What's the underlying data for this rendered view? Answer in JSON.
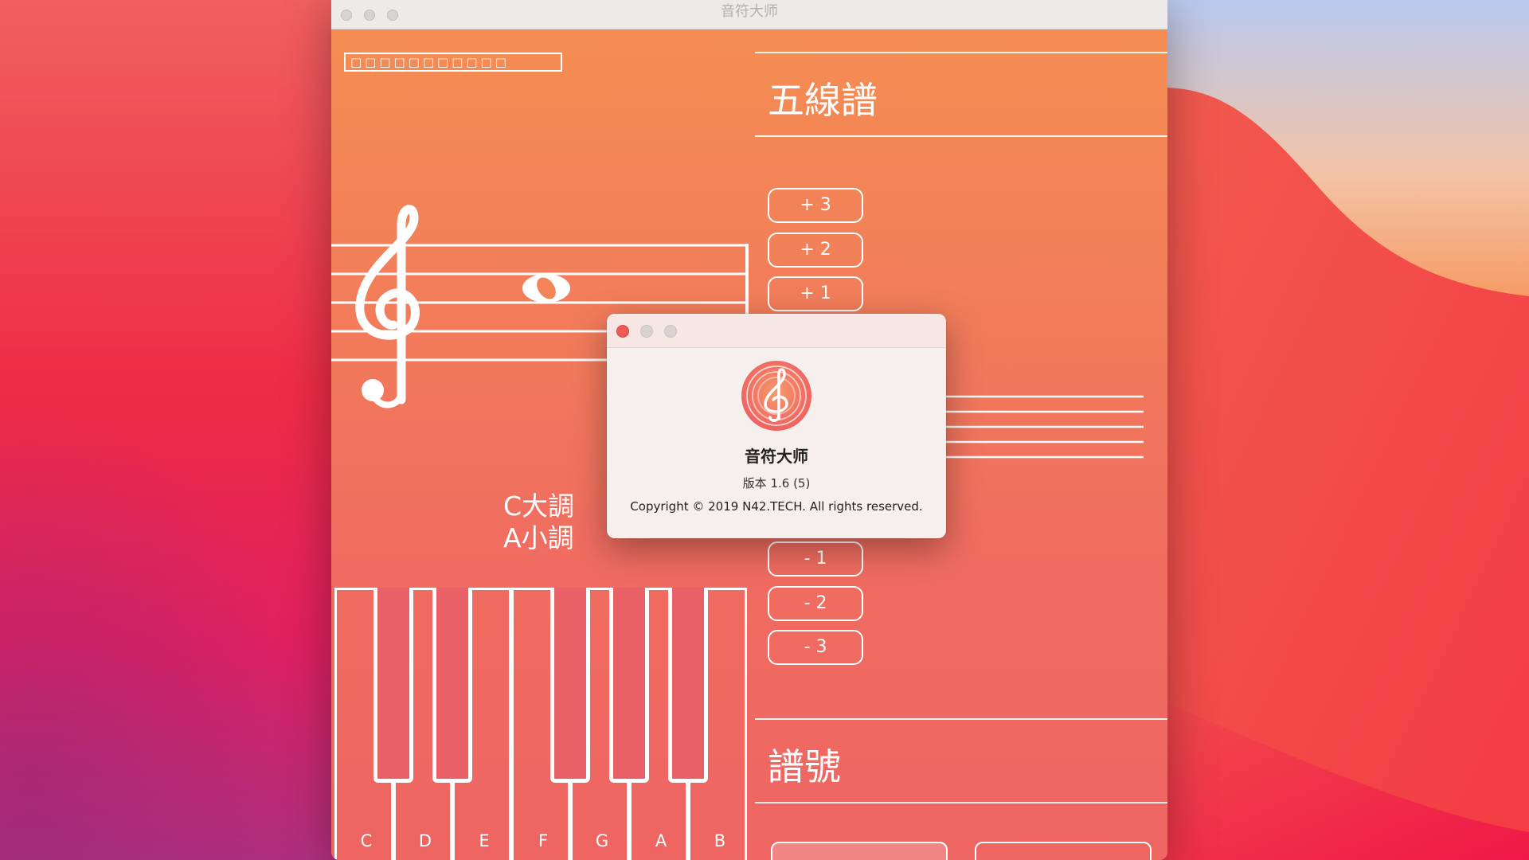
{
  "window": {
    "title": "音符大师"
  },
  "header": {
    "glyph_placeholder": "□□□□□□□□□□□"
  },
  "staff_section": {
    "title": "五線譜"
  },
  "shift_buttons": {
    "plus3": "+ 3",
    "plus2": "+ 2",
    "plus1": "+ 1",
    "minus1": "- 1",
    "minus2": "- 2",
    "minus3": "- 3"
  },
  "key_signature": {
    "major": "C大調",
    "minor": "A小調"
  },
  "piano": {
    "white_keys": [
      "C",
      "D",
      "E",
      "F",
      "G",
      "A",
      "B"
    ]
  },
  "clef_section": {
    "title": "譜號"
  },
  "about_dialog": {
    "app_name": "音符大师",
    "version": "版本 1.6 (5)",
    "copyright": "Copyright © 2019 N42.TECH. All rights reserved."
  },
  "colors": {
    "window_top": "#f48f52",
    "window_bottom": "#ee6562",
    "black_key": "#e96166",
    "close_red": "#ee5a55"
  }
}
